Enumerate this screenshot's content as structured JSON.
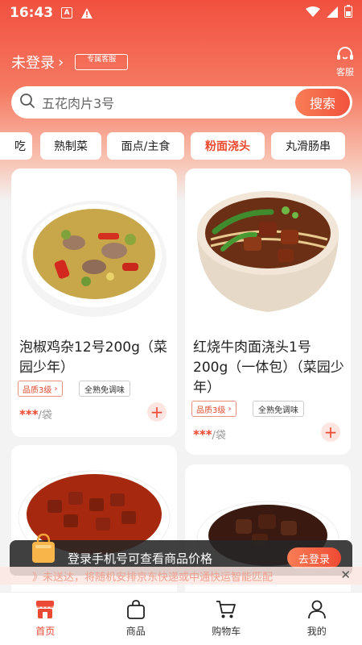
{
  "status_bar": {
    "time": "16:43"
  },
  "header": {
    "login_text": "未登录",
    "service_tag": "专属客服",
    "service_label": "客服"
  },
  "search": {
    "placeholder": "五花肉片3号",
    "button": "搜索"
  },
  "categories": [
    {
      "label": "吃"
    },
    {
      "label": "熟制菜"
    },
    {
      "label": "面点/主食"
    },
    {
      "label": "粉面浇头",
      "active": true
    },
    {
      "label": "丸滑肠串"
    }
  ],
  "products": [
    {
      "title": "泡椒鸡杂12号200g（菜园少年）",
      "quality": "品质3级",
      "taste": "全熟免调味",
      "price": "***",
      "unit": "/袋"
    },
    {
      "title": "红烧牛肉面浇头1号200g（一体包）（菜园少年）",
      "quality": "品质3级",
      "taste": "全熟免调味",
      "price": "***",
      "unit": "/袋"
    }
  ],
  "login_banner": {
    "text": "登录手机号可查看商品价格",
    "button": "去登录"
  },
  "marquee": {
    "text": "》未送达，将随机安排京东快递或中通快运智能匹配"
  },
  "tabbar": [
    {
      "label": "首页",
      "active": true
    },
    {
      "label": "商品"
    },
    {
      "label": "购物车"
    },
    {
      "label": "我的"
    }
  ],
  "colors": {
    "accent": "#ea4a33",
    "header_top": "#f2503f"
  }
}
